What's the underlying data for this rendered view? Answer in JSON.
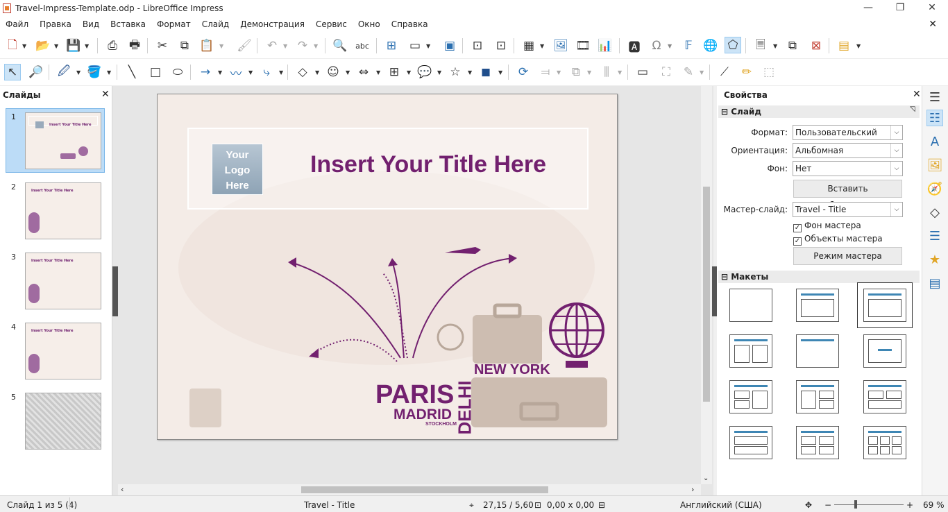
{
  "window": {
    "title": "Travel-Impress-Template.odp - LibreOffice Impress",
    "minimize": "—",
    "maximize": "❐",
    "close": "✕"
  },
  "menu": [
    "Файл",
    "Правка",
    "Вид",
    "Вставка",
    "Формат",
    "Слайд",
    "Демонстрация",
    "Сервис",
    "Окно",
    "Справка"
  ],
  "slides_panel": {
    "title": "Слайды",
    "close": "✕",
    "thumbs": [
      {
        "num": "1",
        "title": "Insert Your Title Here"
      },
      {
        "num": "2",
        "title": "Insert Your Title Here"
      },
      {
        "num": "3",
        "title": "Insert Your Title Here"
      },
      {
        "num": "4",
        "title": "Insert Your Title Here"
      },
      {
        "num": "5",
        "title": ""
      }
    ]
  },
  "slide": {
    "logo_lines": [
      "Your",
      "Logo",
      "Here"
    ],
    "title": "Insert Your Title Here",
    "cities": {
      "paris": "PARIS",
      "madrid": "MADRID",
      "stockholm": "STOCKHOLM",
      "delhi": "DELHI",
      "newyork": "NEW YORK"
    },
    "colors": {
      "purple": "#72206f",
      "bg": "#f4ece7",
      "suitcase": "#cdbdb1"
    }
  },
  "properties": {
    "title": "Свойства",
    "close": "✕",
    "slide_section": "Слайд",
    "format_label": "Формат:",
    "format_value": "Пользовательский",
    "orientation_label": "Ориентация:",
    "orientation_value": "Альбомная",
    "background_label": "Фон:",
    "background_value": "Нет",
    "insert_image_btn": "Вставить изображение...",
    "master_label": "Мастер-слайд:",
    "master_value": "Travel - Title",
    "master_bg_chk": "Фон мастера",
    "master_obj_chk": "Объекты мастера",
    "master_mode_btn": "Режим мастера",
    "layouts_section": "Макеты"
  },
  "status": {
    "slide": "Слайд 1 из 5 (4)",
    "master": "Travel - Title",
    "position": "27,15 / 5,60",
    "size": "0,00 x 0,00",
    "language": "Английский (США)",
    "zoom": "69 %",
    "zoom_fraction": 0.69
  }
}
